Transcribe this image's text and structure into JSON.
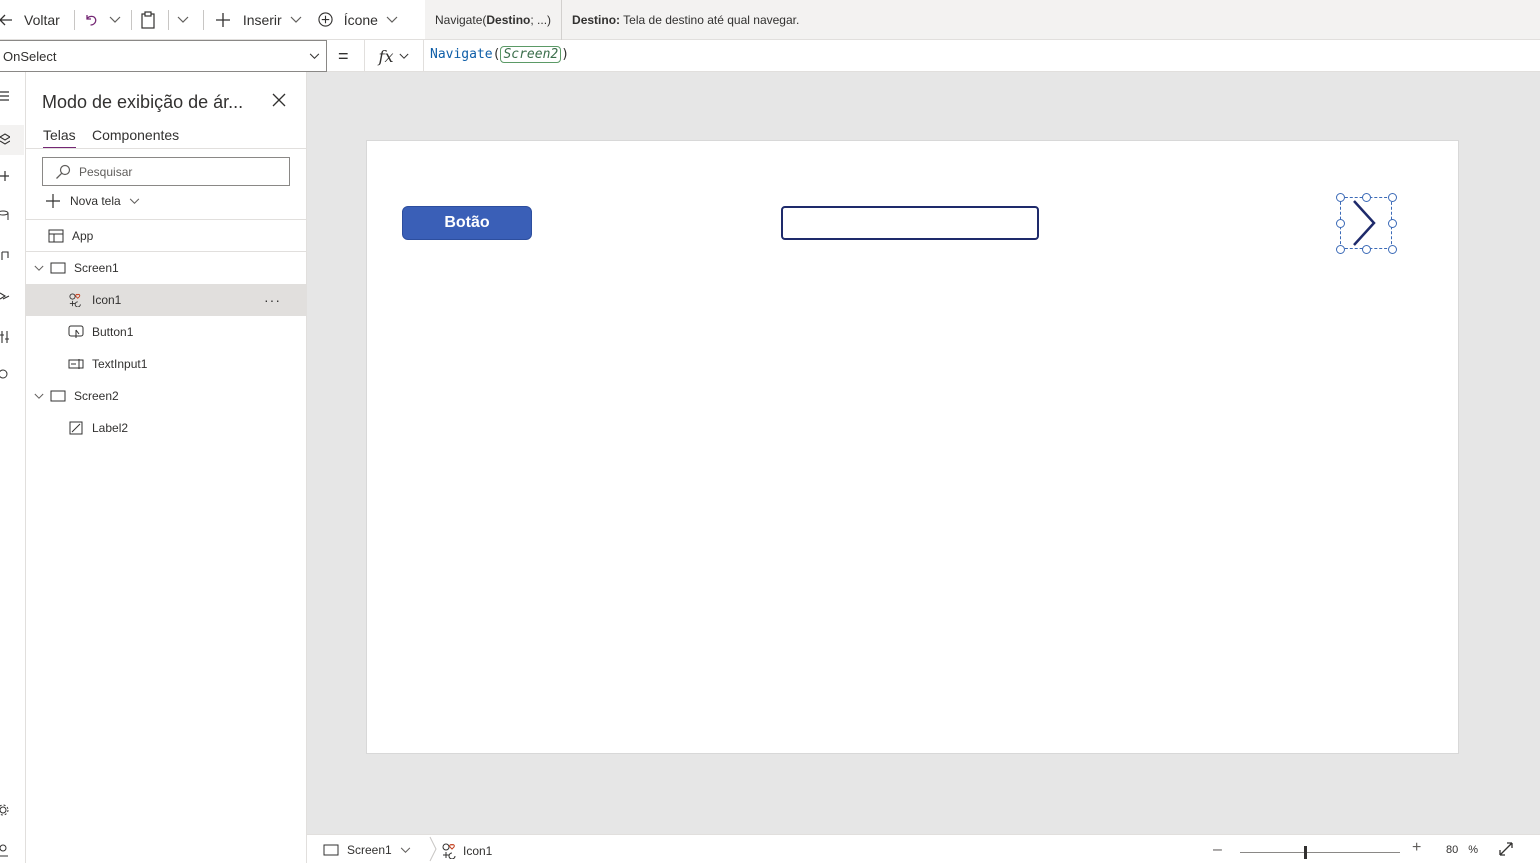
{
  "toolbar": {
    "back_label": "Voltar",
    "insert_label": "Inserir",
    "icon_label": "Ícone"
  },
  "tooltip": {
    "function_name": "Navigate(",
    "param_bold": "Destino",
    "param_rest": "; ...)",
    "desc_label": "Destino:",
    "desc_text": "Tela de destino até qual navegar."
  },
  "formula_bar": {
    "property": "OnSelect",
    "equals": "=",
    "fx": "fx",
    "function": "Navigate",
    "open_paren": "(",
    "argument": "Screen2",
    "close_paren": ")"
  },
  "tree_view": {
    "title": "Modo de exibição de ár...",
    "tabs": [
      "Telas",
      "Componentes"
    ],
    "search_placeholder": "Pesquisar",
    "new_screen_label": "Nova tela",
    "more_label": "···",
    "items": [
      {
        "label": "App"
      },
      {
        "label": "Screen1"
      },
      {
        "label": "Icon1"
      },
      {
        "label": "Button1"
      },
      {
        "label": "TextInput1"
      },
      {
        "label": "Screen2"
      },
      {
        "label": "Label2"
      }
    ]
  },
  "canvas": {
    "button_text": "Botão"
  },
  "status_bar": {
    "screen": "Screen1",
    "control": "Icon1",
    "zoom_value": "80",
    "zoom_unit": "%"
  },
  "colors": {
    "accent": "#742774",
    "button": "#3a5fb7",
    "selection": "#3b6ab7",
    "canvas_bg": "#e6e6e6"
  }
}
